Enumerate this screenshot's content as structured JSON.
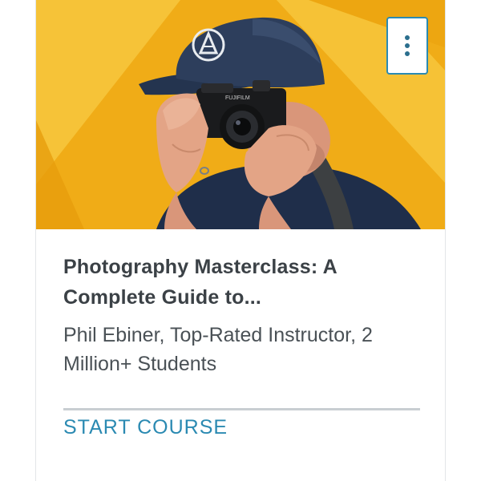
{
  "course_card": {
    "thumbnail": {
      "alt": "Photographer holding a Fujifilm camera",
      "camera_brand": "FUJIFILM",
      "background_color": "#f3b21d",
      "accent_color": "#f6c83a"
    },
    "menu_button": {
      "icon": "kebab-vertical-icon",
      "accent_color": "#2b8ab2"
    },
    "title": "Photography Masterclass: A Complete Guide to...",
    "instructor": "Phil Ebiner, Top-Rated Instructor, 2 Million+ Students",
    "cta_label": "START COURSE",
    "cta_color": "#2b8ab2"
  }
}
